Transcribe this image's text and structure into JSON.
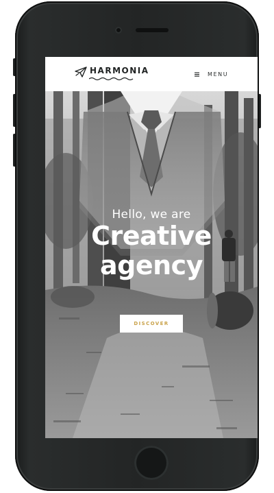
{
  "brand": {
    "name": "HARMONIA",
    "logo_icon": "paper-plane-icon"
  },
  "nav": {
    "menu_label": "MENU",
    "menu_icon": "hamburger-icon"
  },
  "hero": {
    "intro": "Hello, we are",
    "title_line1": "Creative",
    "title_line2": "agency",
    "cta_label": "DISCOVER"
  },
  "colors": {
    "accent": "#c9a24a",
    "device_frame": "#232525",
    "text_dark": "#1f2222",
    "hero_text": "#ffffff"
  }
}
